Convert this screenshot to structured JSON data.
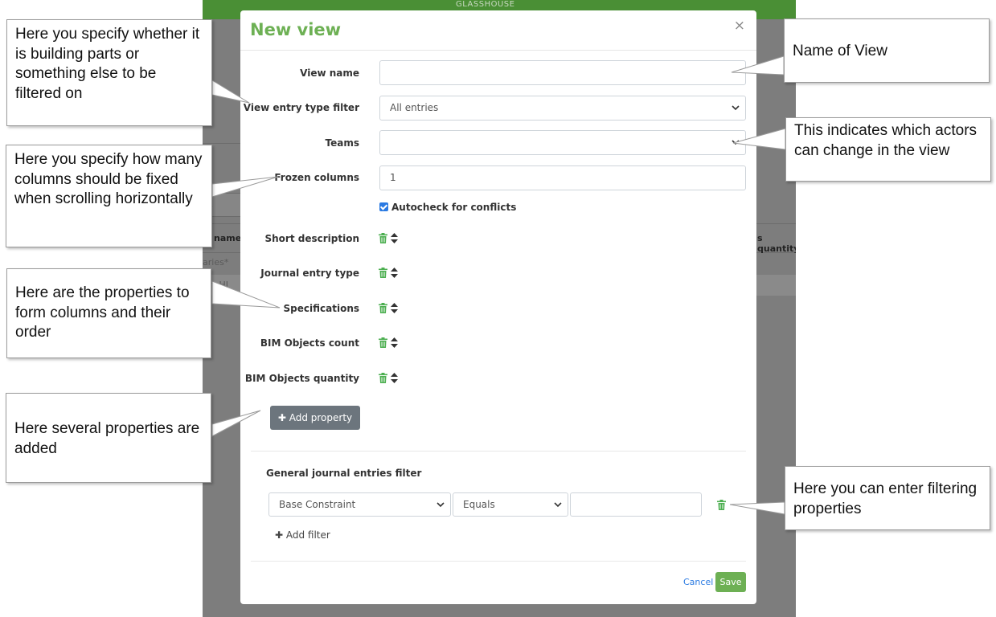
{
  "background": {
    "brand": "GLASSHOUSE",
    "ghost_texts": [
      "s",
      "name",
      "aries*",
      "ors HI",
      "s quantity"
    ]
  },
  "modal": {
    "title": "New view",
    "close_label": "×",
    "fields": {
      "view_name_label": "View name",
      "view_name_value": "",
      "entry_type_label": "View entry type filter",
      "entry_type_value": "All entries",
      "teams_label": "Teams",
      "teams_value": "",
      "frozen_label": "Frozen columns",
      "frozen_value": "1",
      "autocheck_label": "Autocheck for conflicts",
      "autocheck_checked": true
    },
    "properties": [
      {
        "label": "Short description"
      },
      {
        "label": "Journal entry type"
      },
      {
        "label": "Specifications"
      },
      {
        "label": "BIM Objects count"
      },
      {
        "label": "BIM Objects quantity"
      }
    ],
    "add_property_label": "✚ Add property",
    "filter_section_title": "General journal entries filter",
    "filter": {
      "property_value": "Base Constraint",
      "operator_value": "Equals",
      "value": ""
    },
    "add_filter_label": "✚ Add filter",
    "cancel_label": "Cancel",
    "save_label": "Save"
  },
  "callouts": {
    "building_parts": "Here you specify whether it is building parts or something else to be filtered on",
    "frozen_columns": "Here you specify how many columns should be fixed when scrolling horizontally",
    "properties": "Here are the properties to form columns and their order",
    "add_property": "Here several properties are added",
    "view_name": "Name of View",
    "teams": "This indicates which actors can change in the view",
    "filter": "Here you can enter filtering properties"
  },
  "colors": {
    "brand_green": "#6db054",
    "link_blue": "#2a7ae2",
    "button_gray": "#6c757d",
    "overlay_gray": "#7d7d7d"
  }
}
